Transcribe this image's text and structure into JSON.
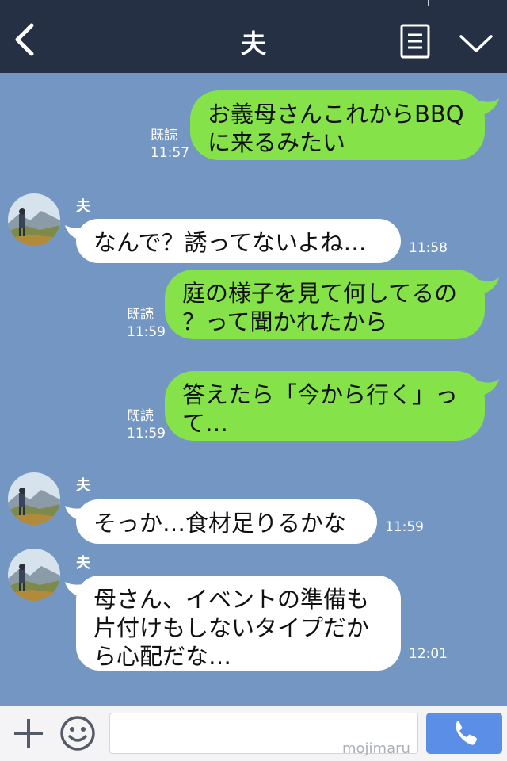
{
  "header": {
    "title": "夫"
  },
  "messages": [
    {
      "type": "out",
      "lines": [
        "お義母さんこれからBBQ",
        "に来るみたい"
      ],
      "read": "既読",
      "time": "11:57"
    },
    {
      "type": "in",
      "sender": "夫",
      "lines": [
        "なんで？誘ってないよね…"
      ],
      "time": "11:58"
    },
    {
      "type": "out",
      "lines": [
        "庭の様子を見て何してるの",
        "？って聞かれたから"
      ],
      "read": "既読",
      "time": "11:59"
    },
    {
      "type": "out",
      "lines": [
        "答えたら「今から行く」っ",
        "て…"
      ],
      "read": "既読",
      "time": "11:59"
    },
    {
      "type": "in",
      "sender": "夫",
      "lines": [
        "そっか…食材足りるかな"
      ],
      "time": "11:59"
    },
    {
      "type": "in",
      "sender": "夫",
      "lines": [
        "母さん、イベントの準備も",
        "片付けもしないタイプだか",
        "ら心配だな…"
      ],
      "time": "12:01"
    }
  ],
  "footer": {
    "watermark": "mojimaru"
  },
  "colors": {
    "background": "#7496c3",
    "header": "#263045",
    "out_bubble": "#85e249",
    "in_bubble": "#ffffff",
    "call_button": "#5b8ee6"
  },
  "icons": [
    "back-arrow-icon",
    "menu-list-icon",
    "chevron-down-icon",
    "plus-icon",
    "emoji-icon",
    "phone-icon"
  ]
}
